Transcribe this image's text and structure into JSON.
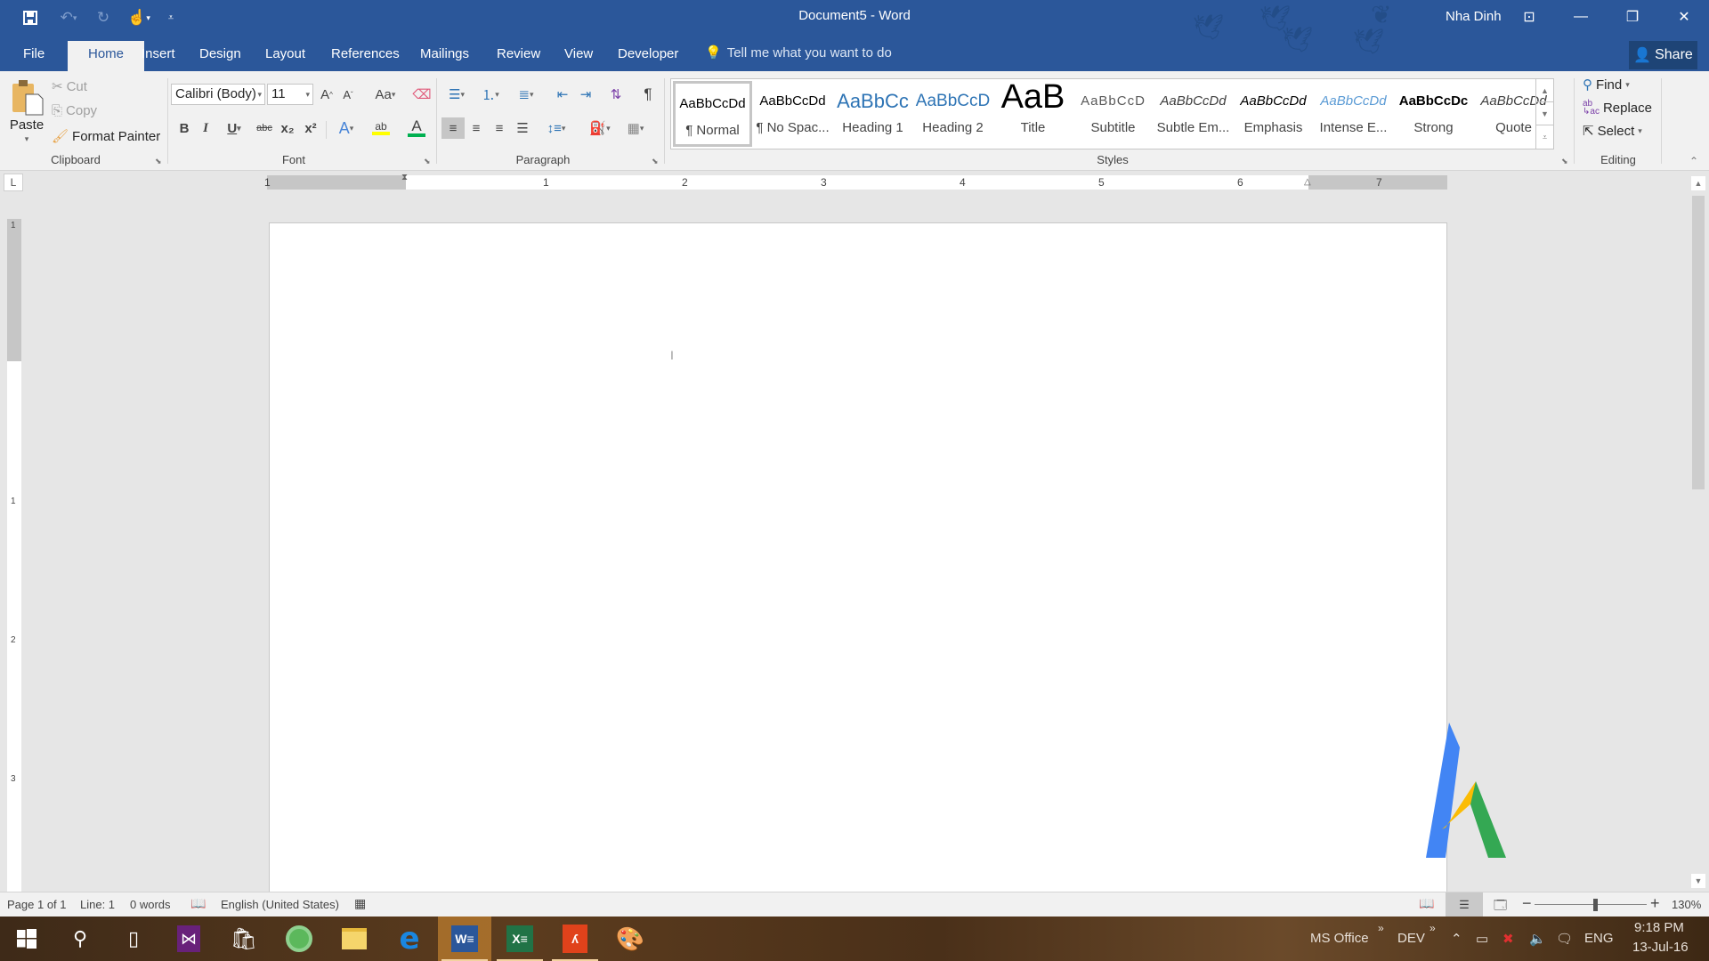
{
  "window": {
    "title": "Document5 - Word",
    "user": "Nha Dinh",
    "controls": {
      "minimize": "—",
      "restore": "❐",
      "close": "✕",
      "ribbon_display": "⊡"
    }
  },
  "quick_access": {
    "save_icon": "save-icon",
    "undo_icon": "undo-icon",
    "redo_icon": "redo-icon",
    "touch_mode_icon": "touch-mode-icon",
    "customize_icon": "customize-qat-icon"
  },
  "tabs": [
    {
      "label": "File"
    },
    {
      "label": "Home",
      "active": true
    },
    {
      "label": "Insert"
    },
    {
      "label": "Design"
    },
    {
      "label": "Layout"
    },
    {
      "label": "References"
    },
    {
      "label": "Mailings"
    },
    {
      "label": "Review"
    },
    {
      "label": "View"
    },
    {
      "label": "Developer"
    }
  ],
  "tell_me": "Tell me what you want to do",
  "share_label": "Share",
  "ribbon": {
    "clipboard": {
      "label": "Clipboard",
      "paste": "Paste",
      "cut": "Cut",
      "copy": "Copy",
      "format_painter": "Format Painter"
    },
    "font": {
      "label": "Font",
      "font_name": "Calibri (Body)",
      "font_size": "11",
      "bold": "B",
      "italic": "I",
      "underline": "U",
      "strikethrough": "abc",
      "subscript": "x₂",
      "superscript": "x²",
      "change_case": "Aa",
      "grow": "A",
      "shrink": "A",
      "text_effects": "A",
      "font_color": "A",
      "highlight": "ab",
      "highlight_color": "#ffff00",
      "font_color_value": "#00b050"
    },
    "paragraph": {
      "label": "Paragraph",
      "pilcrow": "¶"
    },
    "styles": {
      "label": "Styles",
      "items": [
        {
          "preview": "AaBbCcDd",
          "name": "¶ Normal",
          "selected": true
        },
        {
          "preview": "AaBbCcDd",
          "name": "¶ No Spac..."
        },
        {
          "preview": "AaBbCc",
          "name": "Heading 1"
        },
        {
          "preview": "AaBbCcD",
          "name": "Heading 2"
        },
        {
          "preview": "AaB",
          "name": "Title"
        },
        {
          "preview": "AaBbCcD",
          "name": "Subtitle"
        },
        {
          "preview": "AaBbCcDd",
          "name": "Subtle Em..."
        },
        {
          "preview": "AaBbCcDd",
          "name": "Emphasis"
        },
        {
          "preview": "AaBbCcDd",
          "name": "Intense E..."
        },
        {
          "preview": "AaBbCcDc",
          "name": "Strong"
        },
        {
          "preview": "AaBbCcDd",
          "name": "Quote"
        }
      ]
    },
    "editing": {
      "label": "Editing",
      "find": "Find",
      "replace": "Replace",
      "select": "Select"
    }
  },
  "ruler": {
    "horizontal_numbers": [
      "1",
      "1",
      "2",
      "3",
      "4",
      "5",
      "6",
      "7"
    ],
    "vertical_numbers": [
      "1",
      "1",
      "2",
      "3"
    ],
    "tab_selector": "L"
  },
  "status": {
    "page": "Page 1 of 1",
    "line": "Line: 1",
    "words": "0 words",
    "language": "English (United States)",
    "zoom": "130%",
    "zoom_percent": 130
  },
  "taskbar": {
    "apps": [
      {
        "name": "start",
        "glyph": "⊞"
      },
      {
        "name": "search",
        "glyph": "⚲"
      },
      {
        "name": "task-view",
        "glyph": "▢"
      },
      {
        "name": "visual-studio",
        "glyph": "⋈"
      },
      {
        "name": "store",
        "glyph": "🛍"
      },
      {
        "name": "coccoc",
        "glyph": "◐"
      },
      {
        "name": "file-explorer",
        "glyph": "📁"
      },
      {
        "name": "edge",
        "glyph": "e"
      },
      {
        "name": "word",
        "glyph": "W",
        "active": true
      },
      {
        "name": "excel",
        "glyph": "X"
      },
      {
        "name": "acrobat",
        "glyph": "A"
      },
      {
        "name": "paint",
        "glyph": "🎨"
      }
    ],
    "toolbars": [
      "MS Office",
      "DEV"
    ],
    "language": "ENG",
    "time": "9:18 PM",
    "date": "13-Jul-16"
  },
  "colors": {
    "word_blue": "#2b579a",
    "ribbon_bg": "#f1f1f1",
    "heading_blue": "#2e74b5"
  }
}
